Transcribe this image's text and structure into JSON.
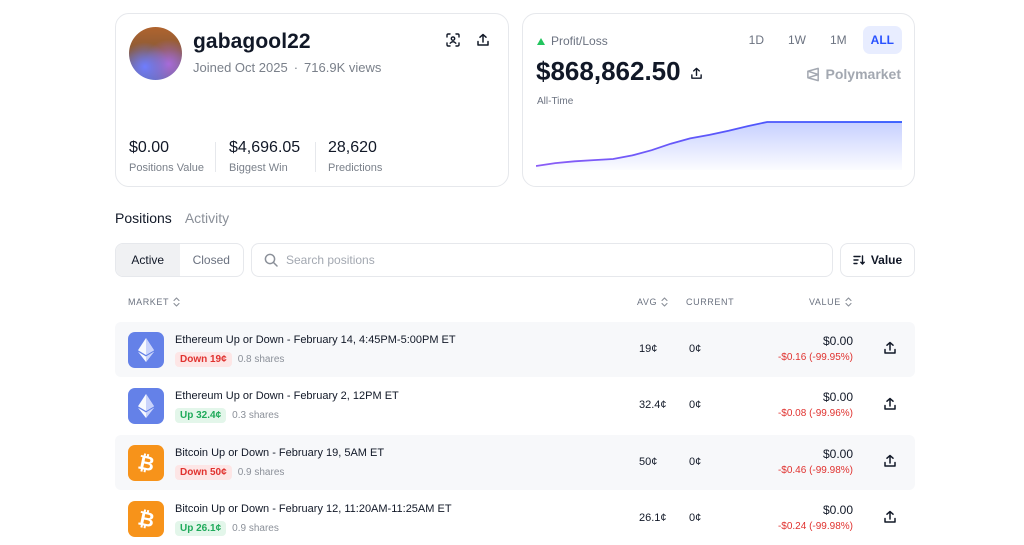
{
  "profile": {
    "username": "gabagool22",
    "joined": "Joined Oct 2025",
    "views": "716.9K views",
    "stats": [
      {
        "value": "$0.00",
        "label": "Positions Value"
      },
      {
        "value": "$4,696.05",
        "label": "Biggest Win"
      },
      {
        "value": "28,620",
        "label": "Predictions"
      }
    ]
  },
  "pnl": {
    "label": "Profit/Loss",
    "value": "$868,862.50",
    "period": "All-Time",
    "brand": "Polymarket",
    "ranges": [
      "1D",
      "1W",
      "1M",
      "ALL"
    ],
    "active_range": "ALL",
    "trend": [
      0.0,
      0.05,
      0.08,
      0.1,
      0.12,
      0.18,
      0.27,
      0.38,
      0.47,
      0.53,
      0.6,
      0.68,
      0.75,
      0.75,
      0.75,
      0.75,
      0.75,
      0.75,
      0.75,
      0.75
    ],
    "colors": {
      "line_start": "#8b5cf6",
      "line_end": "#2952ff",
      "positive": "#22c55e"
    }
  },
  "tabs": [
    "Positions",
    "Activity"
  ],
  "filter": {
    "active": "Active",
    "closed": "Closed"
  },
  "search": {
    "placeholder": "Search positions"
  },
  "sort": {
    "label": "Value"
  },
  "table": {
    "headers": {
      "market": "MARKET",
      "avg": "AVG",
      "current": "CURRENT",
      "value": "VALUE"
    },
    "rows": [
      {
        "coin": "ethereum",
        "title": "Ethereum Up or Down - February 14, 4:45PM-5:00PM ET",
        "outcome": "Down 19¢",
        "direction": "down",
        "shares": "0.8 shares",
        "avg": "19¢",
        "current": "0¢",
        "value": "$0.00",
        "change": "-$0.16 (-99.95%)"
      },
      {
        "coin": "ethereum",
        "title": "Ethereum Up or Down - February 2, 12PM ET",
        "outcome": "Up 32.4¢",
        "direction": "up",
        "shares": "0.3 shares",
        "avg": "32.4¢",
        "current": "0¢",
        "value": "$0.00",
        "change": "-$0.08 (-99.96%)"
      },
      {
        "coin": "bitcoin",
        "title": "Bitcoin Up or Down - February 19, 5AM ET",
        "outcome": "Down 50¢",
        "direction": "down",
        "shares": "0.9 shares",
        "avg": "50¢",
        "current": "0¢",
        "value": "$0.00",
        "change": "-$0.46 (-99.98%)"
      },
      {
        "coin": "bitcoin",
        "title": "Bitcoin Up or Down - February 12, 11:20AM-11:25AM ET",
        "outcome": "Up 26.1¢",
        "direction": "up",
        "shares": "0.9 shares",
        "avg": "26.1¢",
        "current": "0¢",
        "value": "$0.00",
        "change": "-$0.24 (-99.98%)"
      }
    ]
  }
}
